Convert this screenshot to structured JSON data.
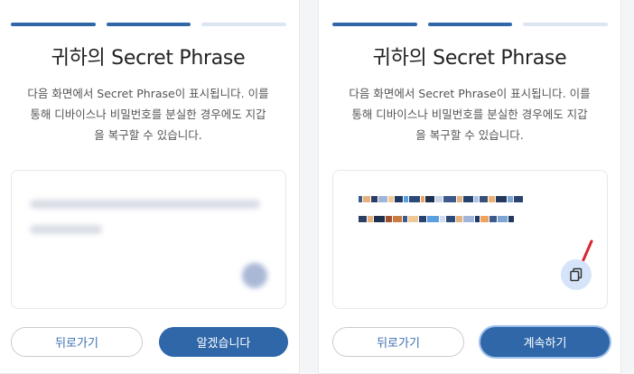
{
  "left": {
    "title": "귀하의 Secret Phrase",
    "description_lines": [
      "다음 화면에서 Secret Phrase이 표시됩니다. 이를",
      "통해 디바이스나 비밀번호를 분실한 경우에도 지갑",
      "을 복구할 수 있습니다."
    ],
    "back_label": "뒤로가기",
    "primary_label": "알겠습니다"
  },
  "right": {
    "title": "귀하의 Secret Phrase",
    "description_lines": [
      "다음 화면에서 Secret Phrase이 표시됩니다. 이를",
      "통해 디바이스나 비밀번호를 분실한 경우에도 지갑",
      "을 복구할 수 있습니다."
    ],
    "back_label": "뒤로가기",
    "primary_label": "계속하기",
    "copy_icon": "copy-icon"
  },
  "steps": {
    "total": 3,
    "completed": 2
  },
  "colors": {
    "primary": "#2f67a9",
    "step_inactive": "#dce6f3",
    "annotation": "#d9262f"
  }
}
